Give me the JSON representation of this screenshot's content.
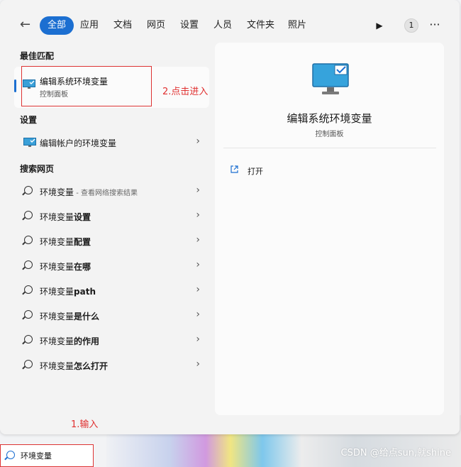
{
  "tabs": [
    {
      "label": "全部",
      "active": true
    },
    {
      "label": "应用"
    },
    {
      "label": "文档"
    },
    {
      "label": "网页"
    },
    {
      "label": "设置"
    },
    {
      "label": "人员"
    },
    {
      "label": "文件夹"
    },
    {
      "label": "照片"
    }
  ],
  "toolbar": {
    "badge": "1",
    "more": "···"
  },
  "sections": {
    "best_match": "最佳匹配",
    "settings": "设置",
    "web": "搜索网页"
  },
  "best_match": {
    "title": "编辑系统环境变量",
    "subtitle": "控制面板"
  },
  "settings_item": {
    "label": "编辑帐户的环境变量"
  },
  "web_items": [
    {
      "pre": "环境变量",
      "bold": "",
      "hint": " - 查看网络搜索结果"
    },
    {
      "pre": "环境变量",
      "bold": "设置",
      "hint": ""
    },
    {
      "pre": "环境变量",
      "bold": "配置",
      "hint": ""
    },
    {
      "pre": "环境变量",
      "bold": "在哪",
      "hint": ""
    },
    {
      "pre": "环境变量",
      "bold": "path",
      "hint": ""
    },
    {
      "pre": "环境变量",
      "bold": "是什么",
      "hint": ""
    },
    {
      "pre": "环境变量",
      "bold": "的作用",
      "hint": ""
    },
    {
      "pre": "环境变量",
      "bold": "怎么打开",
      "hint": ""
    }
  ],
  "preview": {
    "title": "编辑系统环境变量",
    "subtitle": "控制面板",
    "open_label": "打开"
  },
  "annotations": {
    "step1": "1.输入",
    "step2": "2.点击进入"
  },
  "search": {
    "value": "环境变量"
  },
  "watermark": "CSDN @给点sun,就shine",
  "colors": {
    "accent": "#1c6fd1",
    "annotation": "#e03030"
  }
}
